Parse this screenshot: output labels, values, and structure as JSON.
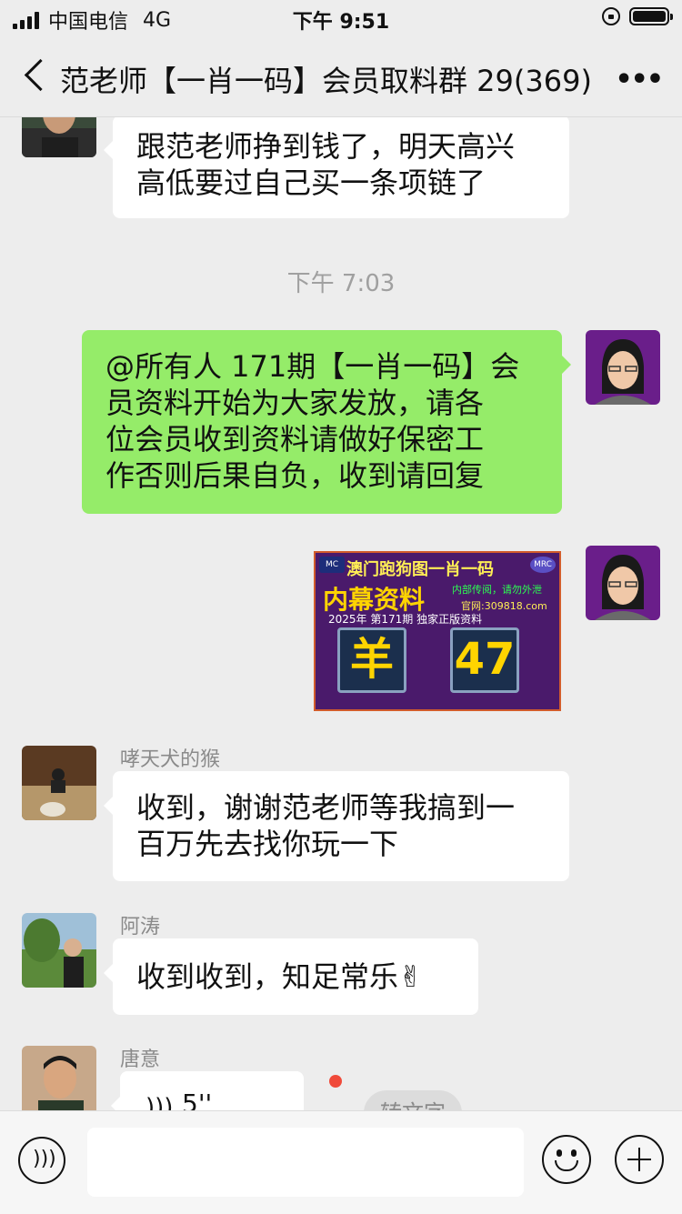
{
  "status_bar": {
    "carrier": "中国电信",
    "network": "4G",
    "time": "下午 9:51"
  },
  "nav": {
    "title": "范老师【一肖一码】会员取料群 29(369)",
    "more_icon": "more-dots-icon",
    "back_icon": "chevron-left-icon"
  },
  "messages": [
    {
      "type": "text",
      "side": "left",
      "text_line1": "跟范老师挣到钱了，明天高兴",
      "text_line2": "高低要过自己买一条项链了"
    },
    {
      "type": "time",
      "text": "下午 7:03"
    },
    {
      "type": "text",
      "side": "right",
      "lines": [
        "@所有人 171期【一肖一码】会",
        "员资料开始为大家发放，请各",
        "位会员收到资料请做好保密工",
        "作否则后果自负，收到请回复"
      ]
    },
    {
      "type": "image",
      "side": "right",
      "image_text": {
        "title": "澳门跑狗图一肖一码",
        "subtitle": "内幕资料",
        "green_text": "内部传阅，请勿外泄",
        "site": "官网:309818.com",
        "issue": "2025年 第171期 独家正版资料",
        "zodiac": "羊",
        "number": "47",
        "logo_left": "MC",
        "logo_right": "MRC"
      }
    },
    {
      "type": "text",
      "side": "left",
      "sender": "哮天犬的猴",
      "lines": [
        "收到，谢谢范老师等我搞到一",
        "百万先去找你玩一下"
      ]
    },
    {
      "type": "text",
      "side": "left",
      "sender": "阿涛",
      "text": "收到收到，知足常乐✌"
    },
    {
      "type": "voice",
      "side": "left",
      "sender": "唐意",
      "duration": "5''",
      "convert_label": "转文字"
    }
  ],
  "input_bar": {
    "voice_icon": "voice-mode-icon",
    "emoji_icon": "emoji-icon",
    "plus_icon": "plus-icon",
    "placeholder": ""
  }
}
